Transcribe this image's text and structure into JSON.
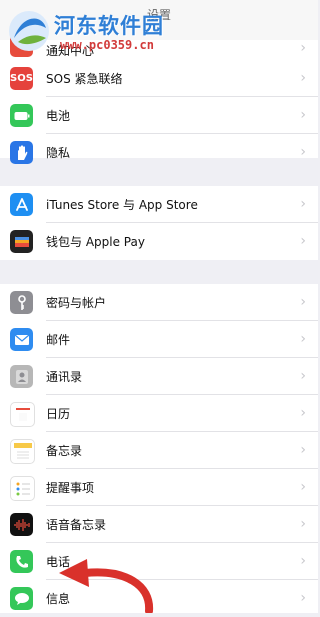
{
  "topbar": {
    "title": "设置"
  },
  "watermark": {
    "title": "河东软件园",
    "url": "www.pc0359.cn"
  },
  "groups": [
    {
      "items": [
        {
          "label": "通知中心",
          "icon": "notifications-icon",
          "color": "#e74c3c"
        },
        {
          "label": "SOS 紧急联络",
          "icon": "sos-icon",
          "color": "#e5423c",
          "glyph": "SOS"
        },
        {
          "label": "电池",
          "icon": "battery-icon",
          "color": "#34c759"
        },
        {
          "label": "隐私",
          "icon": "hand-icon",
          "color": "#2a76e6"
        }
      ]
    },
    {
      "items": [
        {
          "label": "iTunes Store 与 App Store",
          "icon": "app-store-icon",
          "color": "#1e8ff2"
        },
        {
          "label": "钱包与 Apple Pay",
          "icon": "wallet-icon",
          "color": "#222222"
        }
      ]
    },
    {
      "items": [
        {
          "label": "密码与帐户",
          "icon": "key-icon",
          "color": "#8e8e93"
        },
        {
          "label": "邮件",
          "icon": "mail-icon",
          "color": "#2f8cf0"
        },
        {
          "label": "通讯录",
          "icon": "contacts-icon",
          "color": "#b7b7b7"
        },
        {
          "label": "日历",
          "icon": "calendar-icon",
          "color": "#ffffff"
        },
        {
          "label": "备忘录",
          "icon": "notes-icon",
          "color": "#ffffff"
        },
        {
          "label": "提醒事项",
          "icon": "reminders-icon",
          "color": "#ffffff"
        },
        {
          "label": "语音备忘录",
          "icon": "voice-memos-icon",
          "color": "#111111"
        },
        {
          "label": "电话",
          "icon": "phone-icon",
          "color": "#34c759"
        },
        {
          "label": "信息",
          "icon": "messages-icon",
          "color": "#34c759"
        }
      ]
    }
  ]
}
